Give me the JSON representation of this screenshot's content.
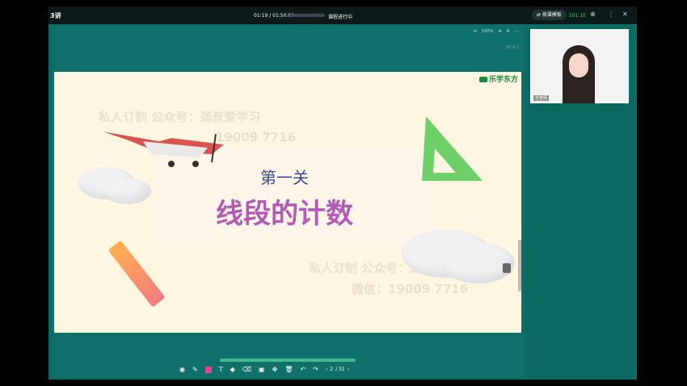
{
  "titlebar": {
    "lesson": "3讲",
    "time": "01:19 / 01:50:00",
    "status": "课程进行中",
    "switch_label": "⇄ 按课模板",
    "network": "101.1E"
  },
  "slide_toolbar": {
    "zoom": "100%"
  },
  "version": "V2.4.1",
  "slide": {
    "brand": "乐学东方",
    "subtitle": "第一关",
    "title": "线段的计数",
    "watermark_1": "私人订制 公众号：迦叔爱学习",
    "watermark_2": "19009 7716",
    "watermark_3": "私人订制 公众号：迦叔爱学习",
    "watermark_4": "微信：19009 7716"
  },
  "pager": {
    "current": "2",
    "total": "/ 31"
  },
  "video": {
    "teacher_name": "王老师"
  },
  "colors": {
    "accent": "#0d6b63",
    "pink": "#e84393"
  }
}
